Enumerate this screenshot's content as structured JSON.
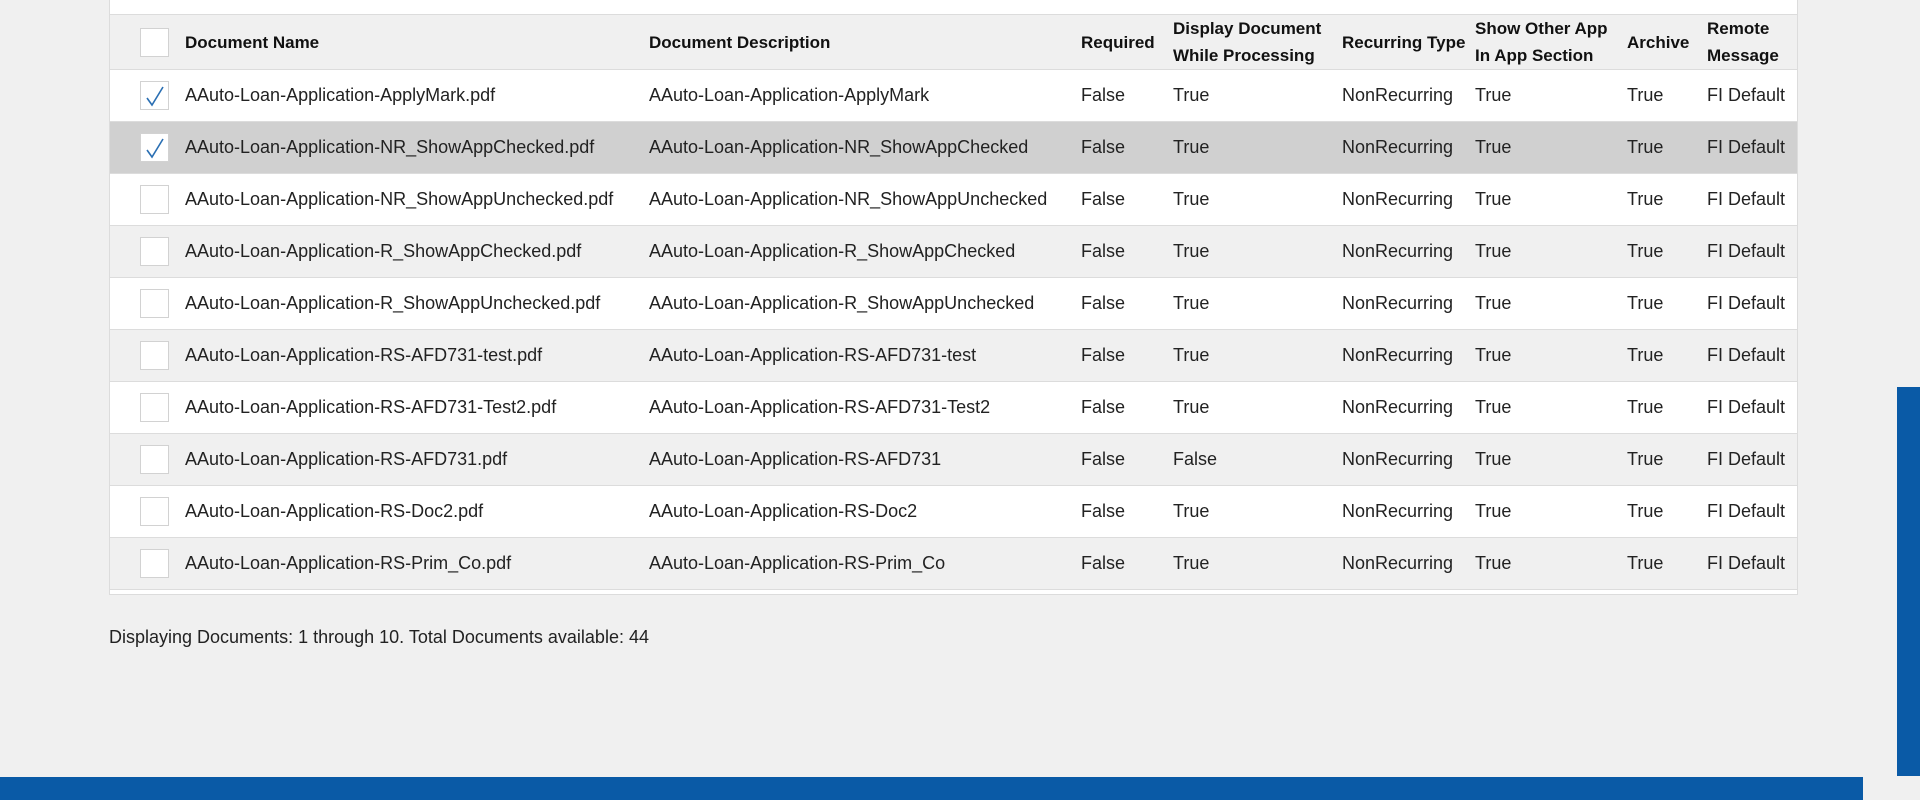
{
  "columns": [
    "",
    "Document Name",
    "Document Description",
    "Required",
    "Display Document While Processing",
    "Recurring Type",
    "Show Other App In App Section",
    "Archive",
    "Remote Message"
  ],
  "rows": [
    {
      "checked": true,
      "selected": false,
      "name": "AAuto-Loan-Application-ApplyMark.pdf",
      "description": "AAuto-Loan-Application-ApplyMark",
      "required": "False",
      "display_while_processing": "True",
      "recurring_type": "NonRecurring",
      "show_other_app": "True",
      "archive": "True",
      "remote_message": "FI Default"
    },
    {
      "checked": true,
      "selected": true,
      "name": "AAuto-Loan-Application-NR_ShowAppChecked.pdf",
      "description": "AAuto-Loan-Application-NR_ShowAppChecked",
      "required": "False",
      "display_while_processing": "True",
      "recurring_type": "NonRecurring",
      "show_other_app": "True",
      "archive": "True",
      "remote_message": "FI Default"
    },
    {
      "checked": false,
      "selected": false,
      "name": "AAuto-Loan-Application-NR_ShowAppUnchecked.pdf",
      "description": "AAuto-Loan-Application-NR_ShowAppUnchecked",
      "required": "False",
      "display_while_processing": "True",
      "recurring_type": "NonRecurring",
      "show_other_app": "True",
      "archive": "True",
      "remote_message": "FI Default"
    },
    {
      "checked": false,
      "selected": false,
      "name": "AAuto-Loan-Application-R_ShowAppChecked.pdf",
      "description": "AAuto-Loan-Application-R_ShowAppChecked",
      "required": "False",
      "display_while_processing": "True",
      "recurring_type": "NonRecurring",
      "show_other_app": "True",
      "archive": "True",
      "remote_message": "FI Default"
    },
    {
      "checked": false,
      "selected": false,
      "name": "AAuto-Loan-Application-R_ShowAppUnchecked.pdf",
      "description": "AAuto-Loan-Application-R_ShowAppUnchecked",
      "required": "False",
      "display_while_processing": "True",
      "recurring_type": "NonRecurring",
      "show_other_app": "True",
      "archive": "True",
      "remote_message": "FI Default"
    },
    {
      "checked": false,
      "selected": false,
      "name": "AAuto-Loan-Application-RS-AFD731-test.pdf",
      "description": "AAuto-Loan-Application-RS-AFD731-test",
      "required": "False",
      "display_while_processing": "True",
      "recurring_type": "NonRecurring",
      "show_other_app": "True",
      "archive": "True",
      "remote_message": "FI Default"
    },
    {
      "checked": false,
      "selected": false,
      "name": "AAuto-Loan-Application-RS-AFD731-Test2.pdf",
      "description": "AAuto-Loan-Application-RS-AFD731-Test2",
      "required": "False",
      "display_while_processing": "True",
      "recurring_type": "NonRecurring",
      "show_other_app": "True",
      "archive": "True",
      "remote_message": "FI Default"
    },
    {
      "checked": false,
      "selected": false,
      "name": "AAuto-Loan-Application-RS-AFD731.pdf",
      "description": "AAuto-Loan-Application-RS-AFD731",
      "required": "False",
      "display_while_processing": "False",
      "recurring_type": "NonRecurring",
      "show_other_app": "True",
      "archive": "True",
      "remote_message": "FI Default"
    },
    {
      "checked": false,
      "selected": false,
      "name": "AAuto-Loan-Application-RS-Doc2.pdf",
      "description": "AAuto-Loan-Application-RS-Doc2",
      "required": "False",
      "display_while_processing": "True",
      "recurring_type": "NonRecurring",
      "show_other_app": "True",
      "archive": "True",
      "remote_message": "FI Default"
    },
    {
      "checked": false,
      "selected": false,
      "name": "AAuto-Loan-Application-RS-Prim_Co.pdf",
      "description": "AAuto-Loan-Application-RS-Prim_Co",
      "required": "False",
      "display_while_processing": "True",
      "recurring_type": "NonRecurring",
      "show_other_app": "True",
      "archive": "True",
      "remote_message": "FI Default"
    }
  ],
  "footer": {
    "status_text": "Displaying Documents: 1 through 10. Total Documents available: 44"
  },
  "colors": {
    "accent": "#0a5aa6",
    "checkmark": "#2a6fb3",
    "selected_row": "#d0d0d0"
  },
  "icons": {
    "checkmark": "checkmark-icon"
  }
}
